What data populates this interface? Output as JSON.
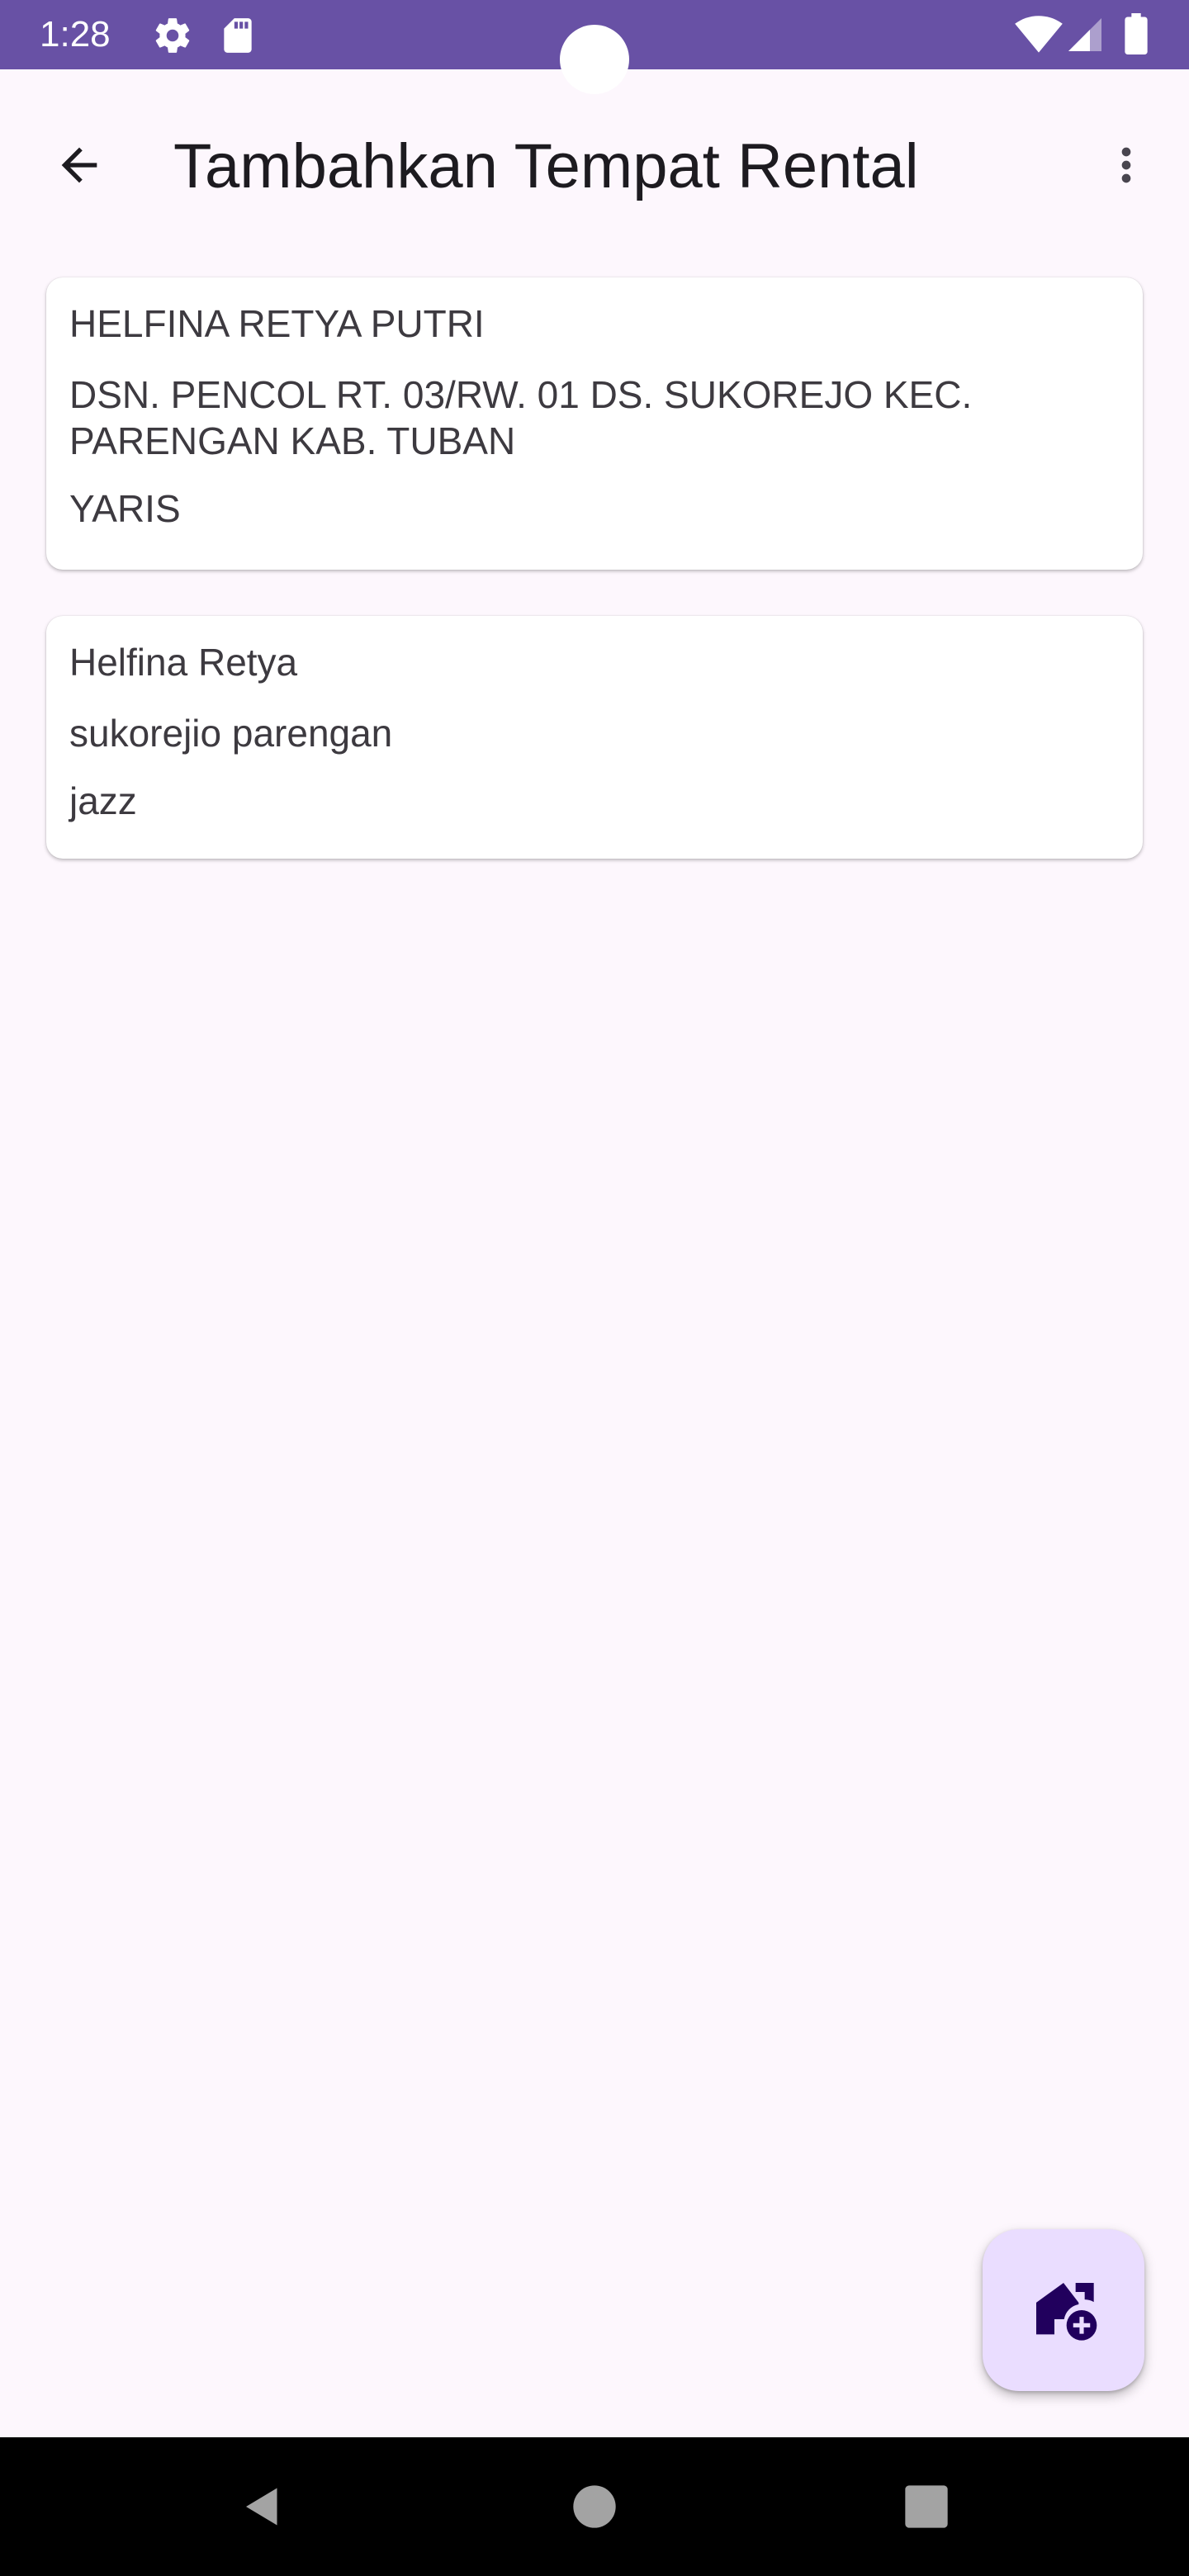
{
  "status_bar": {
    "time": "1:28",
    "icons": [
      "gear-icon",
      "sd-card-icon",
      "wifi-icon",
      "signal-icon",
      "battery-icon"
    ],
    "background": "#6851a5"
  },
  "app_bar": {
    "title": "Tambahkan Tempat Rental",
    "back_icon": "arrow-back-icon",
    "menu_icon": "more-vert-icon"
  },
  "rentals": [
    {
      "name": "HELFINA RETYA PUTRI",
      "address": "DSN. PENCOL RT. 03/RW. 01 DS. SUKOREJO KEC. PARENGAN KAB. TUBAN",
      "car": "YARIS"
    },
    {
      "name": "Helfina Retya",
      "address": "sukorejio parengan",
      "car": "jazz"
    }
  ],
  "fab": {
    "icon": "add-home-icon",
    "background": "#eaddff",
    "icon_color": "#21005d"
  },
  "nav_bar": {
    "icons": [
      "nav-back-icon",
      "nav-home-icon",
      "nav-recents-icon"
    ]
  }
}
